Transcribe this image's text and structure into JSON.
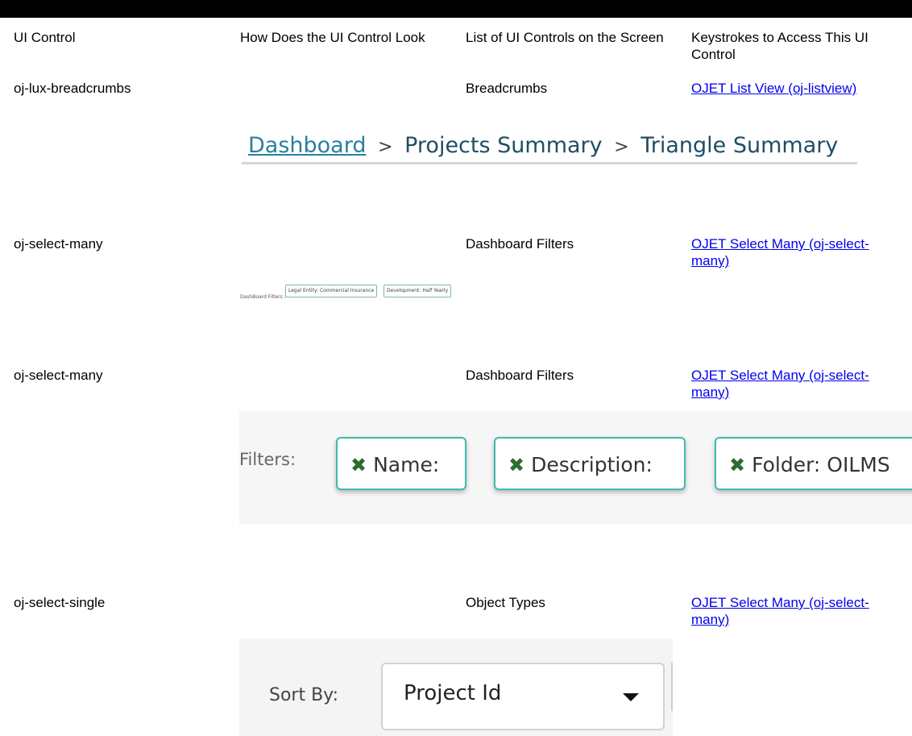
{
  "table": {
    "headers": [
      "UI Control",
      "How Does the UI Control Look",
      "List of UI Controls on the Screen",
      "Keystrokes to Access This UI Control"
    ],
    "rows": [
      {
        "control": "oj-lux-breadcrumbs",
        "list": "Breadcrumbs",
        "keystrokes": "OJET List View (oj-listview)"
      },
      {
        "control": "oj-select-many",
        "list": "Dashboard Filters",
        "keystrokes": "OJET Select Many (oj-select-many)"
      },
      {
        "control": "oj-select-many",
        "list": "Dashboard Filters",
        "keystrokes": "OJET Select Many (oj-select-many)"
      },
      {
        "control": "oj-select-single",
        "list": "Object Types",
        "keystrokes": "OJET Select Many (oj-select-many)"
      }
    ]
  },
  "breadcrumbs_image": {
    "items": [
      "Dashboard",
      "Projects Summary",
      "Triangle Summary"
    ],
    "separator": ">"
  },
  "dashboard_filters_image": {
    "label": "DashBoard Filters :",
    "chips": [
      "Legal Entity: Commercial Insurance",
      "Development: Half Yearly"
    ]
  },
  "filters_image": {
    "label": "Filters:",
    "chips": [
      "Name:",
      "Description:",
      "Folder: OILMS"
    ],
    "remove_glyph": "✖"
  },
  "sort_by_image": {
    "label": "Sort By:",
    "value": "Project Id"
  },
  "colors": {
    "link": "#0000ee",
    "chip_border": "#3fbab0",
    "remove_icon": "#2e6b2f"
  }
}
